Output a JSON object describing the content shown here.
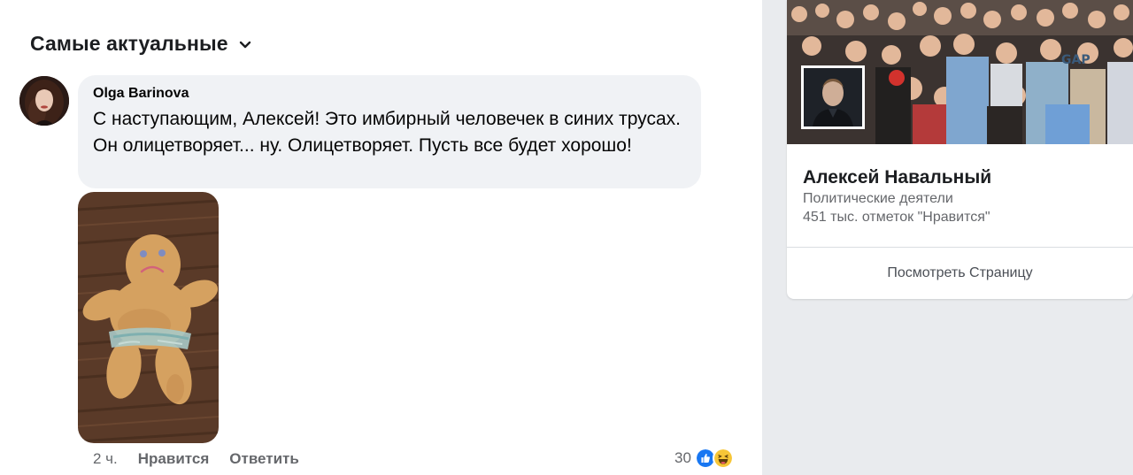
{
  "comments_section": {
    "sort_label": "Самые актуальные"
  },
  "comment": {
    "author": "Olga Barinova",
    "text": "С наступающим, Алексей! Это имбирный человечек в синих трусах. Он олицетворяет... ну. Олицетворяет. Пусть все будет хорошо!",
    "time": "2 ч.",
    "like_label": "Нравится",
    "reply_label": "Ответить",
    "reaction_count": "30",
    "reaction_icons": [
      "like-icon",
      "haha-icon"
    ]
  },
  "page_card": {
    "name": "Алексей Навальный",
    "category": "Политические деятели",
    "likes": "451 тыс. отметок \"Нравится\"",
    "button_label": "Посмотреть Страницу"
  },
  "colors": {
    "bubble": "#f0f2f5",
    "secondary_text": "#65676b",
    "like_blue": "#1877f2",
    "haha_yellow": "#f7c637",
    "sidebar_bg": "#e9ebee"
  }
}
